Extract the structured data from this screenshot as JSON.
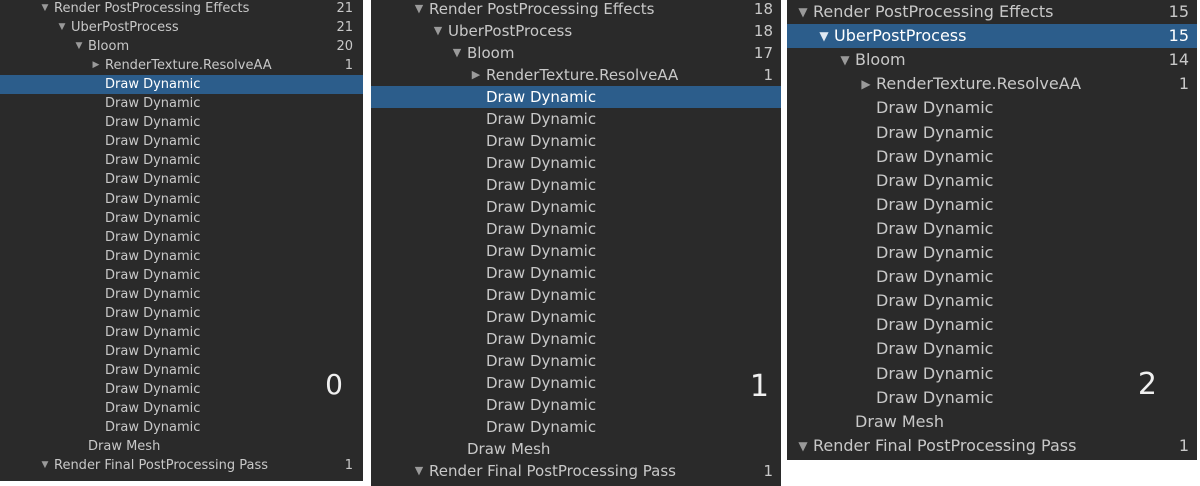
{
  "panels": [
    {
      "badge": "0",
      "rows": [
        {
          "depth": 0,
          "arrow": "down",
          "label": "Render PostProcessing Effects",
          "count": "21"
        },
        {
          "depth": 1,
          "arrow": "down",
          "label": "UberPostProcess",
          "count": "21"
        },
        {
          "depth": 2,
          "arrow": "down",
          "label": "Bloom",
          "count": "20"
        },
        {
          "depth": 3,
          "arrow": "right",
          "label": "RenderTexture.ResolveAA",
          "count": "1"
        },
        {
          "depth": 3,
          "arrow": "",
          "label": "Draw Dynamic",
          "count": "",
          "selected": true
        },
        {
          "depth": 3,
          "arrow": "",
          "label": "Draw Dynamic",
          "count": ""
        },
        {
          "depth": 3,
          "arrow": "",
          "label": "Draw Dynamic",
          "count": ""
        },
        {
          "depth": 3,
          "arrow": "",
          "label": "Draw Dynamic",
          "count": ""
        },
        {
          "depth": 3,
          "arrow": "",
          "label": "Draw Dynamic",
          "count": ""
        },
        {
          "depth": 3,
          "arrow": "",
          "label": "Draw Dynamic",
          "count": ""
        },
        {
          "depth": 3,
          "arrow": "",
          "label": "Draw Dynamic",
          "count": ""
        },
        {
          "depth": 3,
          "arrow": "",
          "label": "Draw Dynamic",
          "count": ""
        },
        {
          "depth": 3,
          "arrow": "",
          "label": "Draw Dynamic",
          "count": ""
        },
        {
          "depth": 3,
          "arrow": "",
          "label": "Draw Dynamic",
          "count": ""
        },
        {
          "depth": 3,
          "arrow": "",
          "label": "Draw Dynamic",
          "count": ""
        },
        {
          "depth": 3,
          "arrow": "",
          "label": "Draw Dynamic",
          "count": ""
        },
        {
          "depth": 3,
          "arrow": "",
          "label": "Draw Dynamic",
          "count": ""
        },
        {
          "depth": 3,
          "arrow": "",
          "label": "Draw Dynamic",
          "count": ""
        },
        {
          "depth": 3,
          "arrow": "",
          "label": "Draw Dynamic",
          "count": ""
        },
        {
          "depth": 3,
          "arrow": "",
          "label": "Draw Dynamic",
          "count": ""
        },
        {
          "depth": 3,
          "arrow": "",
          "label": "Draw Dynamic",
          "count": ""
        },
        {
          "depth": 3,
          "arrow": "",
          "label": "Draw Dynamic",
          "count": ""
        },
        {
          "depth": 3,
          "arrow": "",
          "label": "Draw Dynamic",
          "count": ""
        },
        {
          "depth": 2,
          "arrow": "",
          "label": "Draw Mesh",
          "count": ""
        },
        {
          "depth": 0,
          "arrow": "down",
          "label": "Render Final PostProcessing Pass",
          "count": "1"
        }
      ]
    },
    {
      "badge": "1",
      "rows": [
        {
          "depth": 0,
          "arrow": "down",
          "label": "Render PostProcessing Effects",
          "count": "18"
        },
        {
          "depth": 1,
          "arrow": "down",
          "label": "UberPostProcess",
          "count": "18"
        },
        {
          "depth": 2,
          "arrow": "down",
          "label": "Bloom",
          "count": "17"
        },
        {
          "depth": 3,
          "arrow": "right",
          "label": "RenderTexture.ResolveAA",
          "count": "1"
        },
        {
          "depth": 3,
          "arrow": "",
          "label": "Draw Dynamic",
          "count": "",
          "selected": true
        },
        {
          "depth": 3,
          "arrow": "",
          "label": "Draw Dynamic",
          "count": ""
        },
        {
          "depth": 3,
          "arrow": "",
          "label": "Draw Dynamic",
          "count": ""
        },
        {
          "depth": 3,
          "arrow": "",
          "label": "Draw Dynamic",
          "count": ""
        },
        {
          "depth": 3,
          "arrow": "",
          "label": "Draw Dynamic",
          "count": ""
        },
        {
          "depth": 3,
          "arrow": "",
          "label": "Draw Dynamic",
          "count": ""
        },
        {
          "depth": 3,
          "arrow": "",
          "label": "Draw Dynamic",
          "count": ""
        },
        {
          "depth": 3,
          "arrow": "",
          "label": "Draw Dynamic",
          "count": ""
        },
        {
          "depth": 3,
          "arrow": "",
          "label": "Draw Dynamic",
          "count": ""
        },
        {
          "depth": 3,
          "arrow": "",
          "label": "Draw Dynamic",
          "count": ""
        },
        {
          "depth": 3,
          "arrow": "",
          "label": "Draw Dynamic",
          "count": ""
        },
        {
          "depth": 3,
          "arrow": "",
          "label": "Draw Dynamic",
          "count": ""
        },
        {
          "depth": 3,
          "arrow": "",
          "label": "Draw Dynamic",
          "count": ""
        },
        {
          "depth": 3,
          "arrow": "",
          "label": "Draw Dynamic",
          "count": ""
        },
        {
          "depth": 3,
          "arrow": "",
          "label": "Draw Dynamic",
          "count": ""
        },
        {
          "depth": 3,
          "arrow": "",
          "label": "Draw Dynamic",
          "count": ""
        },
        {
          "depth": 2,
          "arrow": "",
          "label": "Draw Mesh",
          "count": ""
        },
        {
          "depth": 0,
          "arrow": "down",
          "label": "Render Final PostProcessing Pass",
          "count": "1"
        }
      ]
    },
    {
      "badge": "2",
      "rows": [
        {
          "depth": 0,
          "arrow": "down",
          "label": "Render PostProcessing Effects",
          "count": "15"
        },
        {
          "depth": 1,
          "arrow": "down",
          "label": "UberPostProcess",
          "count": "15",
          "selected": true
        },
        {
          "depth": 2,
          "arrow": "down",
          "label": "Bloom",
          "count": "14"
        },
        {
          "depth": 3,
          "arrow": "right",
          "label": "RenderTexture.ResolveAA",
          "count": "1"
        },
        {
          "depth": 3,
          "arrow": "",
          "label": "Draw Dynamic",
          "count": ""
        },
        {
          "depth": 3,
          "arrow": "",
          "label": "Draw Dynamic",
          "count": ""
        },
        {
          "depth": 3,
          "arrow": "",
          "label": "Draw Dynamic",
          "count": ""
        },
        {
          "depth": 3,
          "arrow": "",
          "label": "Draw Dynamic",
          "count": ""
        },
        {
          "depth": 3,
          "arrow": "",
          "label": "Draw Dynamic",
          "count": ""
        },
        {
          "depth": 3,
          "arrow": "",
          "label": "Draw Dynamic",
          "count": ""
        },
        {
          "depth": 3,
          "arrow": "",
          "label": "Draw Dynamic",
          "count": ""
        },
        {
          "depth": 3,
          "arrow": "",
          "label": "Draw Dynamic",
          "count": ""
        },
        {
          "depth": 3,
          "arrow": "",
          "label": "Draw Dynamic",
          "count": ""
        },
        {
          "depth": 3,
          "arrow": "",
          "label": "Draw Dynamic",
          "count": ""
        },
        {
          "depth": 3,
          "arrow": "",
          "label": "Draw Dynamic",
          "count": ""
        },
        {
          "depth": 3,
          "arrow": "",
          "label": "Draw Dynamic",
          "count": ""
        },
        {
          "depth": 3,
          "arrow": "",
          "label": "Draw Dynamic",
          "count": ""
        },
        {
          "depth": 2,
          "arrow": "",
          "label": "Draw Mesh",
          "count": ""
        },
        {
          "depth": 0,
          "arrow": "down",
          "label": "Render Final PostProcessing Pass",
          "count": "1"
        }
      ]
    }
  ]
}
